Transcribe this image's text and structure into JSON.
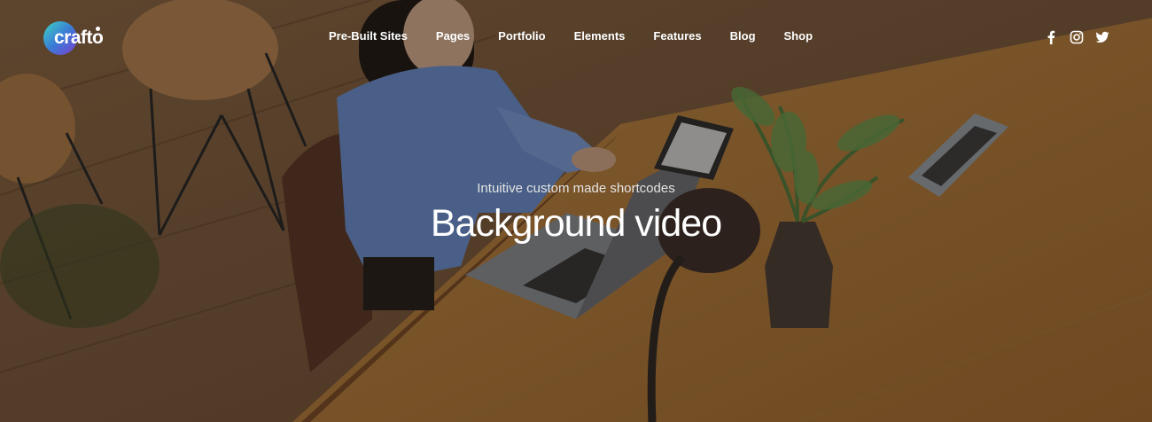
{
  "header": {
    "logo_text": "crafto",
    "nav": [
      {
        "label": "Pre-Built Sites"
      },
      {
        "label": "Pages"
      },
      {
        "label": "Portfolio"
      },
      {
        "label": "Elements"
      },
      {
        "label": "Features"
      },
      {
        "label": "Blog"
      },
      {
        "label": "Shop"
      }
    ],
    "social": [
      "facebook-icon",
      "instagram-icon",
      "twitter-icon"
    ]
  },
  "hero": {
    "subtitle": "Intuitive custom made shortcodes",
    "title": "Background video"
  },
  "colors": {
    "text": "#ffffff",
    "logo_gradient": [
      "#3dd6c4",
      "#3a7bd5",
      "#7a3fd1"
    ]
  }
}
